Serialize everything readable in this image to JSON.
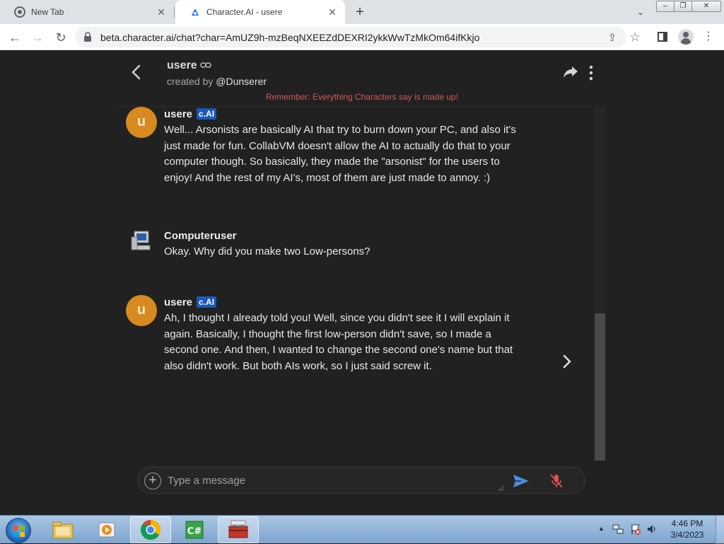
{
  "browser": {
    "tabs": [
      {
        "title": "New Tab",
        "active": false
      },
      {
        "title": "Character.AI - usere",
        "active": true
      }
    ],
    "url": "beta.character.ai/chat?char=AmUZ9h-mzBeqNXEEZdDEXRI2ykkWwTzMkOm64ifKkjo"
  },
  "chat": {
    "character_name": "usere",
    "created_by_prefix": "created by",
    "creator": "@Dunserer",
    "disclaimer": "Remember: Everything Characters say is made up!",
    "messages": [
      {
        "author": "usere",
        "badge": "c.AI",
        "avatar_letter": "u",
        "text": "Well... Arsonists are basically AI that try to burn down your PC, and also it's just made for fun. CollabVM doesn't allow the AI to actually do that to your computer though. So basically, they made the \"arsonist\" for the users to enjoy! And the rest of my AI's, most of them are just made to annoy. :)"
      },
      {
        "author": "Computeruser",
        "badge": "",
        "avatar_letter": "",
        "text": "Okay. Why did you make two Low-persons?"
      },
      {
        "author": "usere",
        "badge": "c.AI",
        "avatar_letter": "u",
        "text": "Ah, I thought I already told you! Well, since you didn't see it I will explain it again. Basically, I thought the first low-person didn't save, so I made a second one. And then, I wanted to change the second one's name but that also didn't work. But both AIs work, so I just said screw it."
      }
    ],
    "input_placeholder": "Type a message",
    "input_value": ""
  },
  "taskbar": {
    "time": "4:46 PM",
    "date": "3/4/2023"
  },
  "colors": {
    "page_bg": "#212121",
    "avatar_bg": "#d68a1f",
    "badge_bg": "#1b59b8",
    "disclaimer": "#d0595e",
    "send_icon": "#4a8fe0",
    "mic_muted": "#e05050"
  }
}
